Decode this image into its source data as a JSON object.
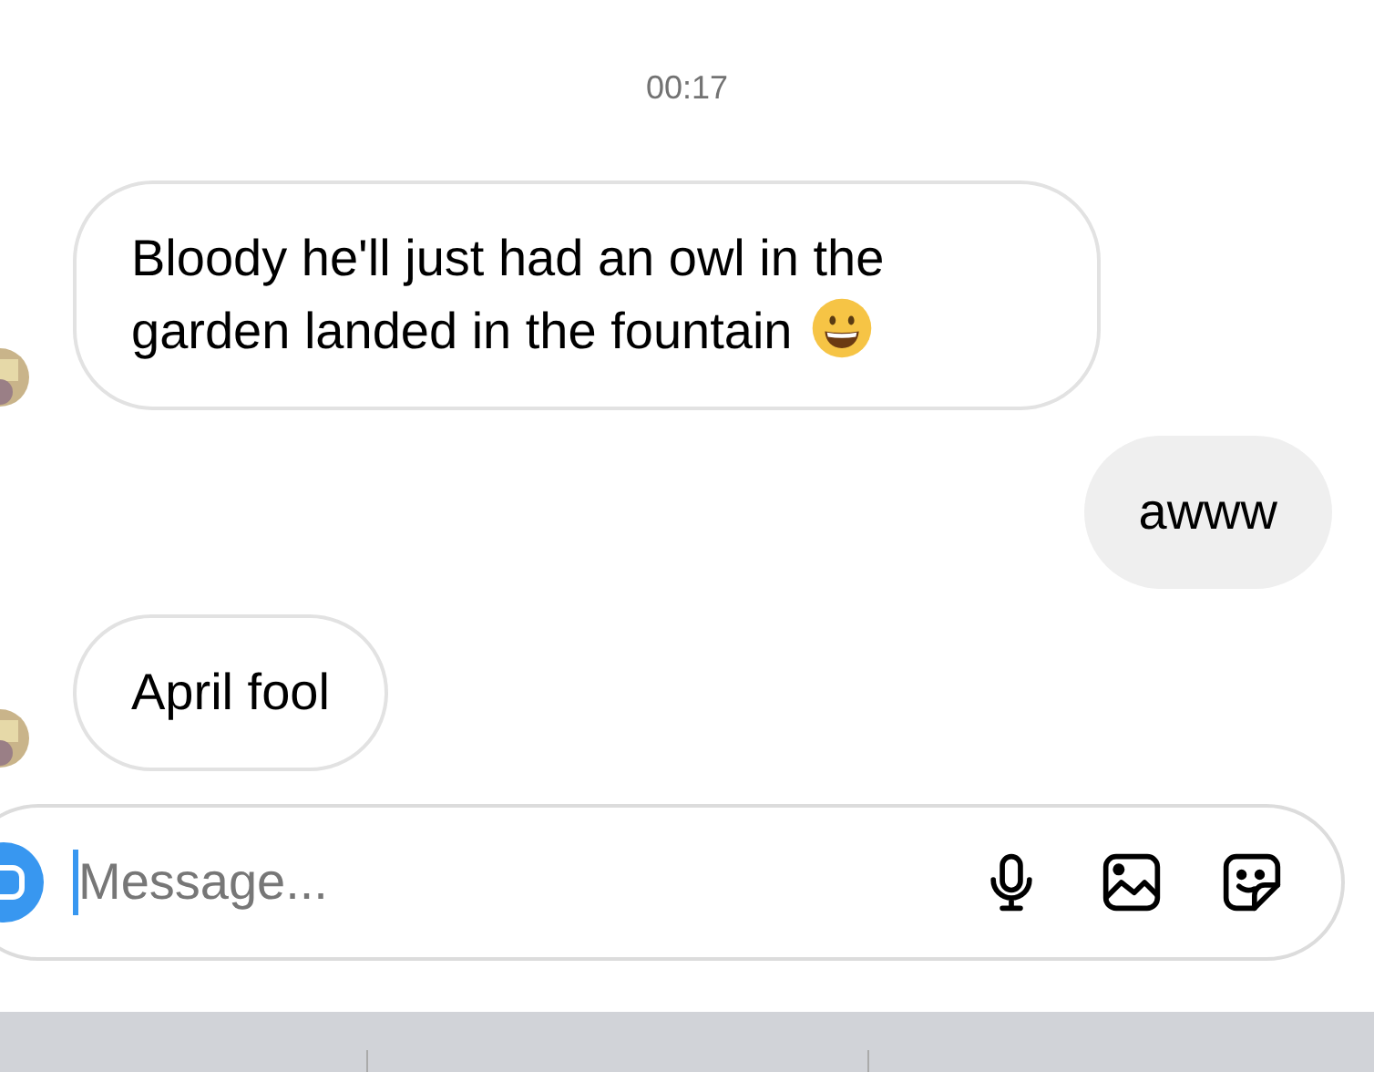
{
  "timestamp": "00:17",
  "messages": [
    {
      "kind": "incoming",
      "text": "Bloody he'll just had an owl in the garden landed in the fountain",
      "emoji": true
    },
    {
      "kind": "outgoing",
      "text": "awww",
      "emoji": false
    },
    {
      "kind": "incoming",
      "text": "April fool",
      "emoji": false
    }
  ],
  "composer": {
    "placeholder": "Message..."
  }
}
